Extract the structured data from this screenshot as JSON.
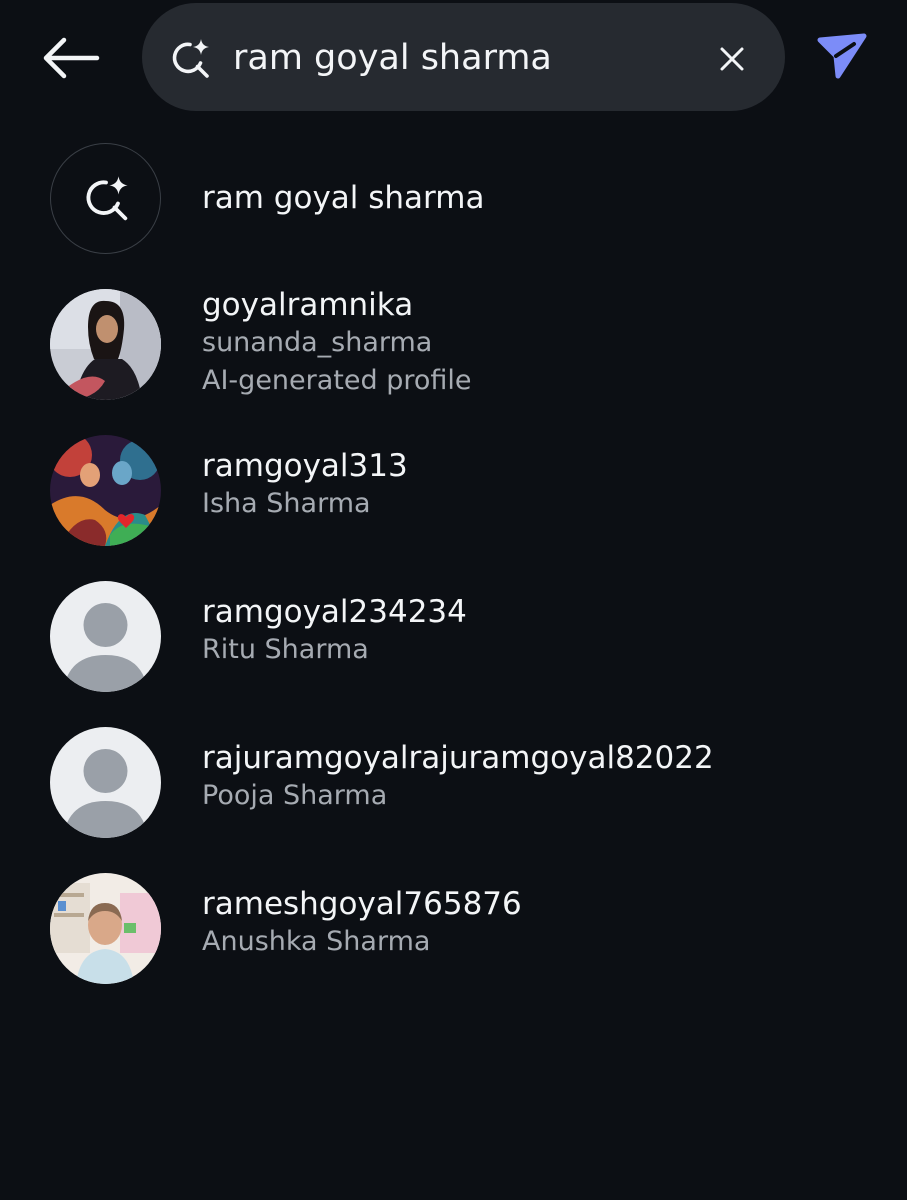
{
  "header": {
    "back_icon": "arrow-left-icon",
    "search": {
      "value": "ram goyal sharma",
      "ai_icon": "ai-search-sparkle-icon",
      "clear_icon": "close-icon"
    },
    "send_icon": "paper-plane-icon",
    "accent_color": "#7c8cf8"
  },
  "results": {
    "query_suggestion": {
      "icon": "ai-search-sparkle-icon",
      "label": "ram goyal sharma"
    },
    "accounts": [
      {
        "username": "goyalramnika",
        "full_name": "sunanda_sharma",
        "note": "AI-generated profile",
        "avatar": "photo-woman"
      },
      {
        "username": "ramgoyal313",
        "full_name": "Isha Sharma",
        "avatar": "photo-artwork"
      },
      {
        "username": "ramgoyal234234",
        "full_name": "Ritu Sharma",
        "avatar": "default-avatar-icon"
      },
      {
        "username": "rajuramgoyalrajuramgoyal82022",
        "full_name": "Pooja Sharma",
        "avatar": "default-avatar-icon"
      },
      {
        "username": "rameshgoyal765876",
        "full_name": "Anushka Sharma",
        "avatar": "photo-child"
      }
    ]
  }
}
